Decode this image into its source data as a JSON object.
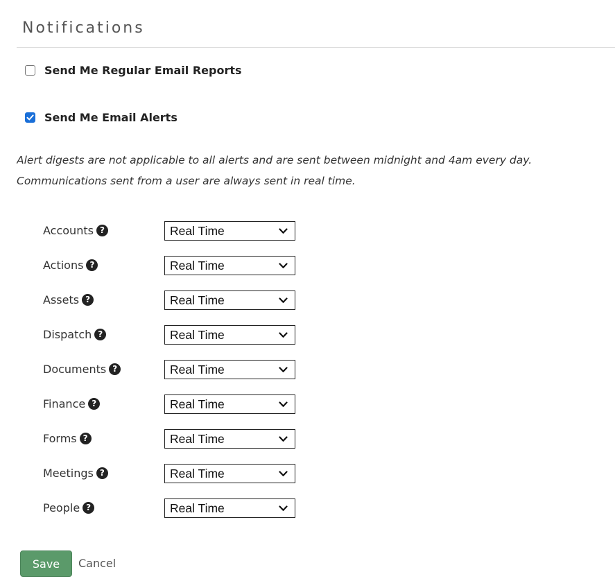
{
  "section": {
    "title": "Notifications"
  },
  "options": {
    "regular_reports": {
      "label": "Send Me Regular Email Reports",
      "checked": false
    },
    "email_alerts": {
      "label": "Send Me Email Alerts",
      "checked": true
    }
  },
  "note": {
    "line1": "Alert digests are not applicable to all alerts and are sent between midnight and 4am every day.",
    "line2": "Communications sent from a user are always sent in real time."
  },
  "alerts": [
    {
      "label": "Accounts",
      "value": "Real Time"
    },
    {
      "label": "Actions",
      "value": "Real Time"
    },
    {
      "label": "Assets",
      "value": "Real Time"
    },
    {
      "label": "Dispatch",
      "value": "Real Time"
    },
    {
      "label": "Documents",
      "value": "Real Time"
    },
    {
      "label": "Finance",
      "value": "Real Time"
    },
    {
      "label": "Forms",
      "value": "Real Time"
    },
    {
      "label": "Meetings",
      "value": "Real Time"
    },
    {
      "label": "People",
      "value": "Real Time"
    }
  ],
  "actions": {
    "save_label": "Save",
    "cancel_label": "Cancel"
  },
  "icons": {
    "help": "question-circle-icon",
    "dropdown": "chevron-down-icon",
    "check": "checkmark-icon"
  },
  "colors": {
    "checkbox_checked": "#1a6fd8",
    "save_button": "#5b9a6a"
  }
}
